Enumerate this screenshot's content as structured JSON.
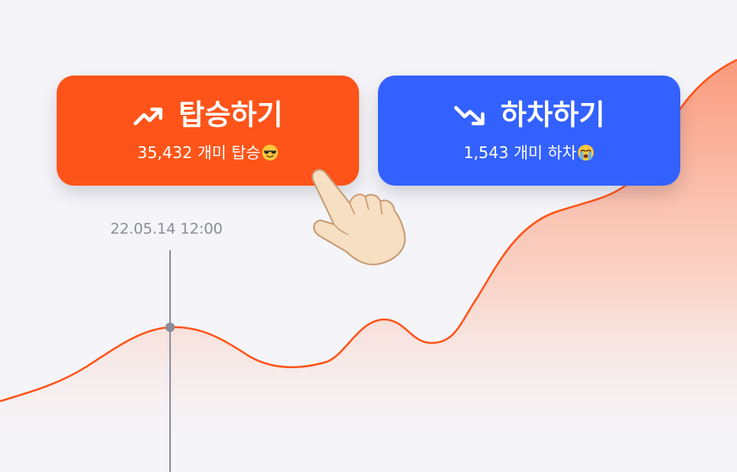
{
  "chart": {
    "timestamp": "22.05.14 12:00",
    "colors": {
      "line": "#ff5419",
      "area_top": "#fa9a7c",
      "crosshair": "#8b8d98"
    }
  },
  "buttons": {
    "up": {
      "label": "탑승하기",
      "count": "35,432",
      "suffix": "개미 탑승",
      "icon": "trending-up-icon",
      "emoji": "sunglasses-emoji",
      "color": "#ff5419"
    },
    "down": {
      "label": "하차하기",
      "count": "1,543",
      "suffix": "개미 하차",
      "icon": "trending-down-icon",
      "emoji": "crying-emoji",
      "color": "#3361ff"
    }
  },
  "pointer": {
    "icon": "pointing-hand-icon"
  }
}
